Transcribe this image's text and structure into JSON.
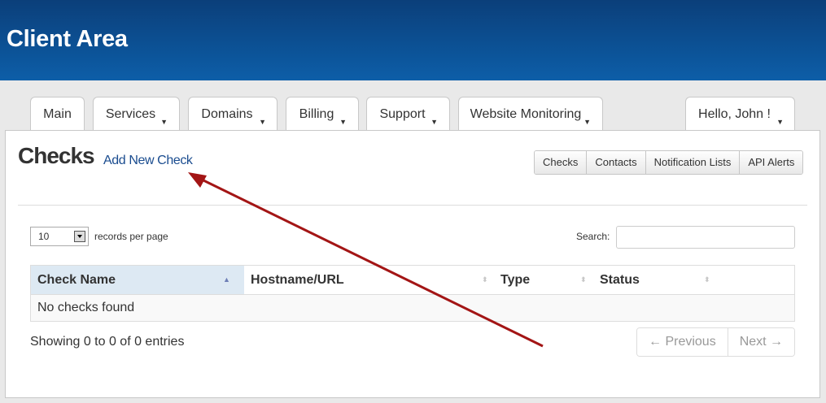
{
  "header": {
    "title": "Client Area"
  },
  "nav": {
    "tabs": [
      {
        "label": "Main",
        "has_caret": false
      },
      {
        "label": "Services",
        "has_caret": true
      },
      {
        "label": "Domains",
        "has_caret": true
      },
      {
        "label": "Billing",
        "has_caret": true
      },
      {
        "label": "Support",
        "has_caret": true
      },
      {
        "label": "Website Monitoring",
        "has_caret": true
      }
    ],
    "user_menu": {
      "label": "Hello, John !",
      "has_caret": true
    }
  },
  "page": {
    "title": "Checks",
    "add_link": "Add New Check",
    "section_buttons": [
      "Checks",
      "Contacts",
      "Notification Lists",
      "API Alerts"
    ]
  },
  "table_controls": {
    "per_page_value": "10",
    "per_page_label": "records per page",
    "search_label": "Search:",
    "search_value": ""
  },
  "table": {
    "columns": [
      {
        "label": "Check Name",
        "sort": "ascending"
      },
      {
        "label": "Hostname/URL",
        "sort": "both"
      },
      {
        "label": "Type",
        "sort": "both"
      },
      {
        "label": "Status",
        "sort": "both"
      }
    ],
    "empty_message": "No checks found"
  },
  "footer": {
    "info": "Showing 0 to 0 of 0 entries",
    "prev_label": "← Previous",
    "next_label": "Next →"
  },
  "colors": {
    "header_top": "#0b3f7a",
    "header_bottom": "#0d5ea8",
    "link": "#1a4c8f",
    "annotation_arrow": "#a31515",
    "sorted_column_bg": "#dde9f3"
  }
}
